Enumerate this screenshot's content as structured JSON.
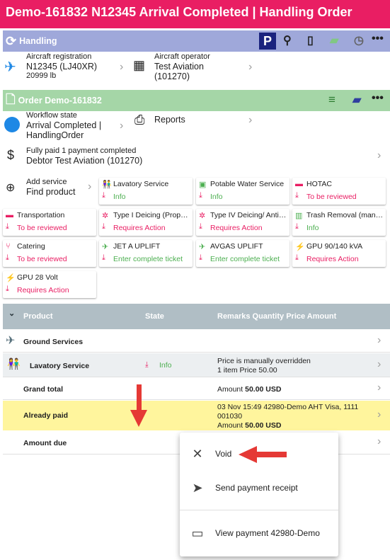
{
  "title": "Demo-161832 N12345 Arrival Completed | Handling Order",
  "handling": {
    "label": "Handling"
  },
  "aircraft": {
    "reg_label": "Aircraft registration",
    "reg": "N12345 (LJ40XR)",
    "weight": "20999 lb",
    "op_label": "Aircraft operator",
    "op": "Test Aviation (101270)"
  },
  "order": {
    "label": "Order Demo-161832"
  },
  "workflow": {
    "label": "Workflow state",
    "value": "Arrival Completed | HandlingOrder",
    "reports": "Reports"
  },
  "payment": {
    "status": "Fully paid 1 payment completed",
    "debtor": "Debtor Test Aviation (101270)"
  },
  "addservice": {
    "label": "Add service",
    "value": "Find product"
  },
  "services": [
    {
      "name": "Lavatory Service",
      "state": "Info"
    },
    {
      "name": "Potable Water Service",
      "state": "Info"
    },
    {
      "name": "HOTAC",
      "state": "To be reviewed"
    },
    {
      "name": "Transportation",
      "state": "To be reviewed"
    },
    {
      "name": "Type I Deicing (Propylene glycol)",
      "state": "Requires Action"
    },
    {
      "name": "Type IV Deicing/ Anti-icing",
      "state": "Requires Action"
    },
    {
      "name": "Trash Removal (manual)",
      "state": "Info"
    },
    {
      "name": "Catering",
      "state": "To be reviewed"
    },
    {
      "name": "JET A UPLIFT",
      "state": "Enter complete ticket"
    },
    {
      "name": "AVGAS UPLIFT",
      "state": "Enter complete ticket"
    },
    {
      "name": "GPU 90/140 kVA",
      "state": "Requires Action"
    },
    {
      "name": "GPU 28 Volt",
      "state": "Requires Action"
    }
  ],
  "table": {
    "headers": {
      "product": "Product",
      "state": "State",
      "rest": "Remarks Quantity Price Amount"
    },
    "group": "Ground Services",
    "lav": {
      "name": "Lavatory Service",
      "state": "Info",
      "remark": "Price is manually overridden",
      "qty": "1 item Price 50.00"
    },
    "grand": {
      "label": "Grand total",
      "prefix": "Amount",
      "amount": "50.00 USD"
    },
    "paid": {
      "label": "Already paid",
      "line1": "03 Nov 15:49 42980-Demo AHT Visa, 1111",
      "line2": "001030",
      "prefix": "Amount",
      "amount": "50.00 USD"
    },
    "due": {
      "label": "Amount due"
    }
  },
  "menu": {
    "void": "Void",
    "receipt": "Send payment receipt",
    "view": "View payment 42980-Demo"
  },
  "colors": {
    "title": "#e91e63",
    "handling": "#9fa8da",
    "order": "#a5d6a7",
    "red": "#e91e63",
    "green": "#4caf50",
    "highlight": "#fff59d",
    "header": "#b0bec5"
  }
}
